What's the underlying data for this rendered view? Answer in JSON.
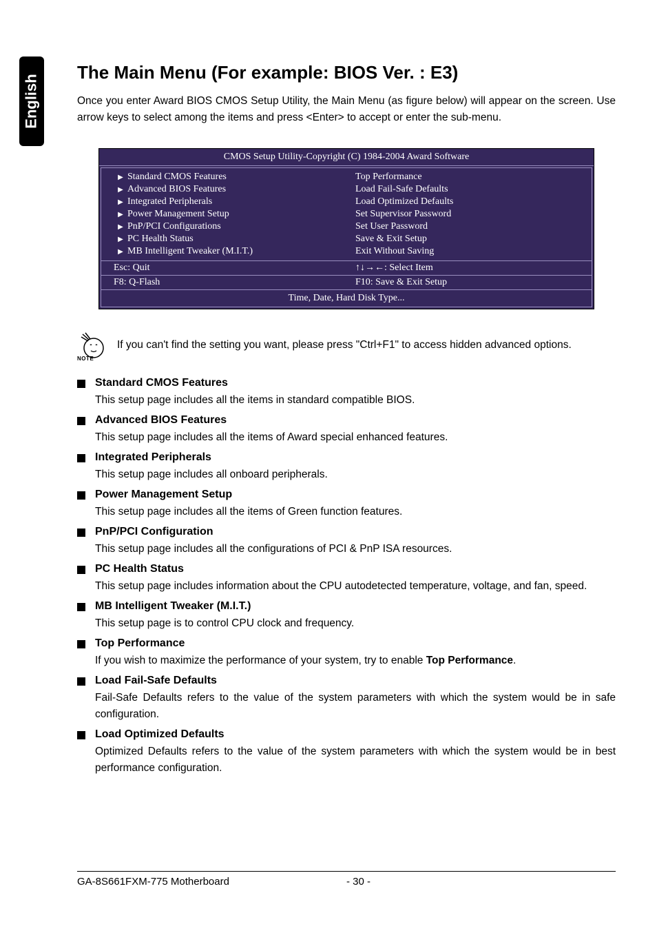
{
  "sideTab": "English",
  "heading": "The Main Menu (For example: BIOS Ver. : E3)",
  "intro": "Once you enter Award BIOS CMOS Setup Utility, the Main Menu (as figure below) will appear on the screen. Use arrow keys to select among the items and press <Enter> to accept or enter the sub-menu.",
  "bios": {
    "title": "CMOS Setup Utility-Copyright (C) 1984-2004 Award Software",
    "left": [
      "Standard CMOS Features",
      "Advanced BIOS Features",
      "Integrated Peripherals",
      "Power Management Setup",
      "PnP/PCI Configurations",
      "PC Health Status",
      "MB Intelligent Tweaker (M.I.T.)"
    ],
    "right": [
      "Top Performance",
      "Load Fail-Safe Defaults",
      "Load Optimized Defaults",
      "Set Supervisor Password",
      "Set User Password",
      "Save & Exit Setup",
      "Exit Without Saving"
    ],
    "footRow1Left": "Esc: Quit",
    "footRow1Right": "↑↓→←: Select Item",
    "footRow2Left": "F8: Q-Flash",
    "footRow2Right": "F10: Save & Exit Setup",
    "help": "Time, Date, Hard Disk Type..."
  },
  "noteLabel": "NOTE",
  "noteText": "If you can't find the setting you want, please press \"Ctrl+F1\" to access hidden advanced options.",
  "sections": [
    {
      "title": "Standard CMOS Features",
      "desc": "This setup page includes all the items in standard compatible BIOS."
    },
    {
      "title": "Advanced BIOS Features",
      "desc": "This setup page includes all the items of Award special enhanced features."
    },
    {
      "title": "Integrated Peripherals",
      "desc": "This setup page includes all onboard peripherals."
    },
    {
      "title": "Power Management Setup",
      "desc": "This setup page includes all the items of Green function features."
    },
    {
      "title": "PnP/PCI Configuration",
      "desc": "This setup page includes all the configurations of PCI & PnP ISA resources."
    },
    {
      "title": "PC Health Status",
      "desc": "This setup page includes information about the CPU autodetected temperature, voltage, and fan, speed."
    },
    {
      "title": "MB Intelligent Tweaker (M.I.T.)",
      "desc": "This setup page is to control CPU clock and frequency."
    },
    {
      "title": "Top Performance",
      "descHtmlParts": [
        "If you wish to maximize the performance of your system, try to enable ",
        "Top Performance",
        "."
      ]
    },
    {
      "title": "Load Fail-Safe Defaults",
      "desc": "Fail-Safe Defaults refers to the value of the system parameters with which the system would be in safe configuration."
    },
    {
      "title": "Load Optimized Defaults",
      "desc": "Optimized Defaults refers to the value of the system parameters with which the system would be in best performance configuration."
    }
  ],
  "footer": {
    "model": "GA-8S661FXM-775 Motherboard",
    "page": "- 30 -"
  }
}
